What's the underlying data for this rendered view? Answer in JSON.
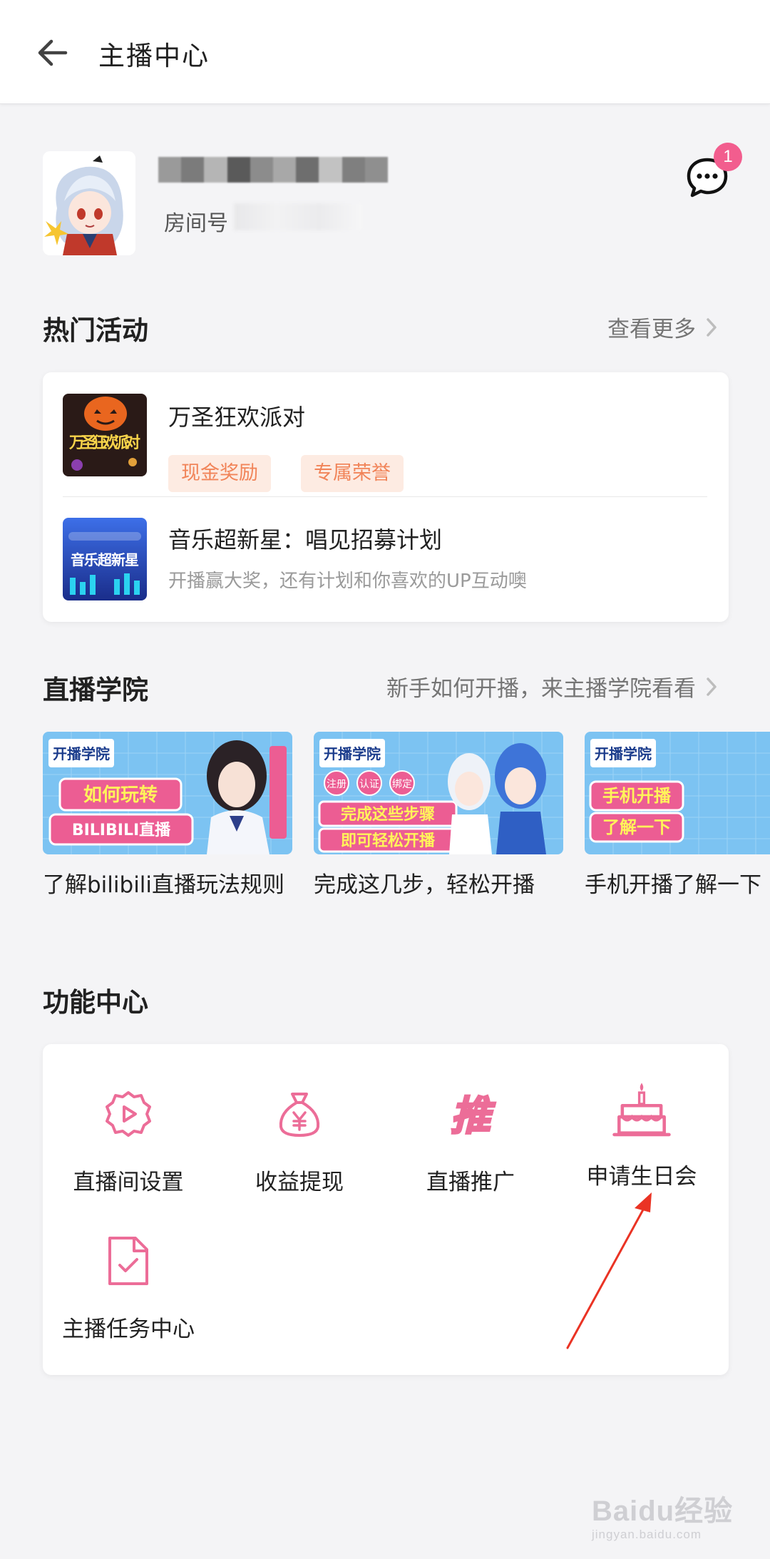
{
  "header": {
    "title": "主播中心"
  },
  "profile": {
    "room_label": "房间号",
    "message_badge": "1"
  },
  "hot_activities": {
    "title": "热门活动",
    "more": "查看更多",
    "items": [
      {
        "title": "万圣狂欢派对",
        "tags": [
          "现金奖励",
          "专属荣誉"
        ],
        "thumb_text": "万圣狂欢派对"
      },
      {
        "title": "音乐超新星：唱见招募计划",
        "subtitle": "开播赢大奖，还有计划和你喜欢的UP互动噢",
        "thumb_text": "音乐超新星"
      }
    ]
  },
  "academy": {
    "title": "直播学院",
    "more": "新手如何开播，来主播学院看看",
    "courses": [
      {
        "title": "了解bilibili直播玩法规则",
        "banner_tag": "开播学院",
        "banner_text": "如何玩转",
        "banner_text2": "BILIBILI直播"
      },
      {
        "title": "完成这几步，轻松开播",
        "banner_tag": "开播学院",
        "banner_text": "完成这些步骤",
        "banner_text2": "即可轻松开播",
        "chips": [
          "注册",
          "认证",
          "绑定"
        ]
      },
      {
        "title": "手机开播了解一下",
        "banner_tag": "开播学院",
        "banner_text": "手机开播",
        "banner_text2": "了解一下"
      }
    ]
  },
  "functions": {
    "title": "功能中心",
    "items": [
      {
        "label": "直播间设置",
        "icon": "play-gear-icon"
      },
      {
        "label": "收益提现",
        "icon": "money-bag-icon"
      },
      {
        "label": "直播推广",
        "icon": "promote-icon"
      },
      {
        "label": "申请生日会",
        "icon": "birthday-cake-icon"
      },
      {
        "label": "主播任务中心",
        "icon": "task-document-icon"
      }
    ],
    "promote_glyph": "推"
  },
  "watermark": {
    "main": "Baidu经验",
    "sub": "jingyan.baidu.com"
  },
  "colors": {
    "accent": "#f25d8e",
    "tag_bg": "#fdebe2",
    "tag_text": "#f18459",
    "annotation": "#ea3324"
  }
}
